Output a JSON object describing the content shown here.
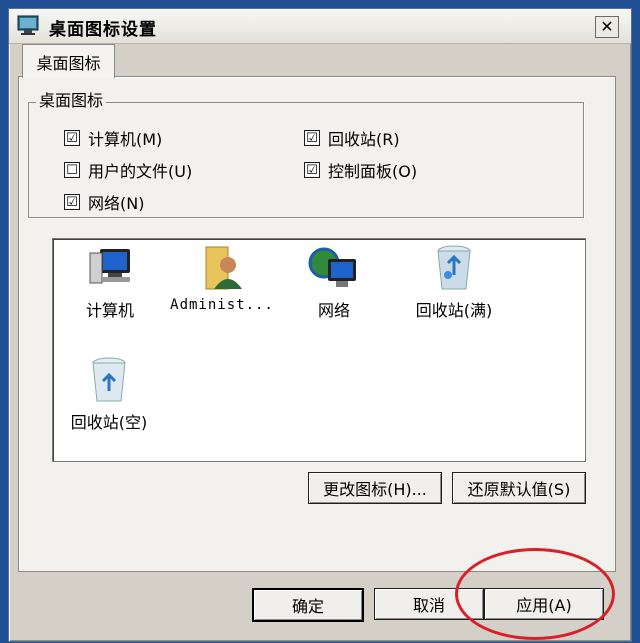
{
  "window": {
    "title": "桌面图标设置",
    "close": "✕"
  },
  "tab": {
    "label": "桌面图标"
  },
  "group": {
    "legend": "桌面图标",
    "checkboxes": [
      {
        "label": "计算机(M)",
        "checked": "☑"
      },
      {
        "label": "回收站(R)",
        "checked": "☑"
      },
      {
        "label": "用户的文件(U)",
        "checked": "☐"
      },
      {
        "label": "控制面板(O)",
        "checked": "☑"
      },
      {
        "label": "网络(N)",
        "checked": "☑"
      }
    ]
  },
  "icons": [
    {
      "label": "计算机",
      "icon": "computer-icon"
    },
    {
      "label": "Administ...",
      "icon": "user-folder-icon"
    },
    {
      "label": "网络",
      "icon": "network-icon"
    },
    {
      "label": "回收站(满)",
      "icon": "recycle-bin-full-icon"
    },
    {
      "label": "回收站(空)",
      "icon": "recycle-bin-empty-icon"
    }
  ],
  "buttons": {
    "change_icon": "更改图标(H)...",
    "restore_default": "还原默认值(S)",
    "ok": "确定",
    "cancel": "取消",
    "apply": "应用(A)"
  },
  "colors": {
    "annotation": "#d8202a",
    "desktop": "#1f4f93"
  }
}
